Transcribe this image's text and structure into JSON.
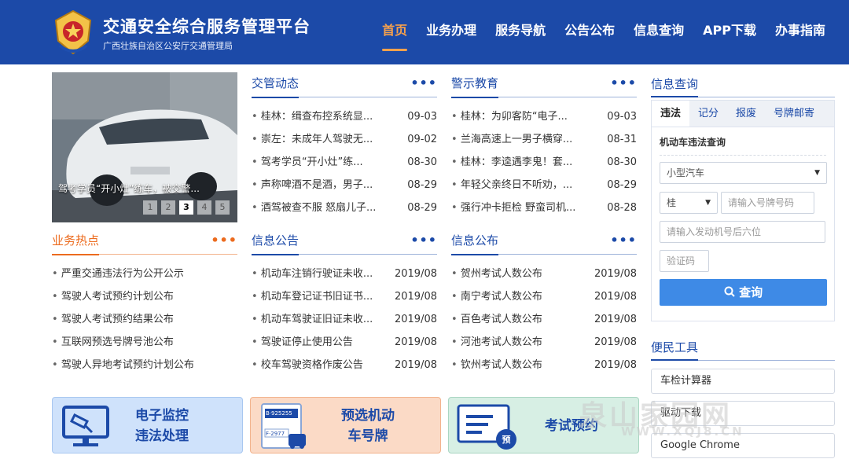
{
  "header": {
    "title": "交通安全综合服务管理平台",
    "subtitle": "广西壮族自治区公安厅交通管理局",
    "nav": [
      "首页",
      "业务办理",
      "服务导航",
      "公告公布",
      "信息查询",
      "APP下载",
      "办事指南"
    ]
  },
  "carousel": {
    "caption": "驾考学员“开小灶”练车，被交警...",
    "dots": [
      "1",
      "2",
      "3",
      "4",
      "5"
    ],
    "active": 3
  },
  "panels": {
    "traffic_news": {
      "title": "交管动态",
      "more": "•••",
      "items": [
        {
          "t": "桂林：缉查布控系统显...",
          "d": "09-03"
        },
        {
          "t": "崇左：未成年人驾驶无...",
          "d": "09-02"
        },
        {
          "t": "驾考学员“开小灶”练...",
          "d": "08-30"
        },
        {
          "t": "声称啤酒不是酒，男子...",
          "d": "08-29"
        },
        {
          "t": "酒驾被查不服 怒扇儿子...",
          "d": "08-29"
        }
      ]
    },
    "warning_edu": {
      "title": "警示教育",
      "more": "•••",
      "items": [
        {
          "t": "桂林：为卯客防“电子...",
          "d": "09-03"
        },
        {
          "t": "兰海高速上一男子横穿...",
          "d": "08-31"
        },
        {
          "t": "桂林：李逵遇李鬼！套...",
          "d": "08-30"
        },
        {
          "t": "年轻父亲终日不听劝，...",
          "d": "08-29"
        },
        {
          "t": "强行冲卡拒检 野蛮司机...",
          "d": "08-28"
        }
      ]
    },
    "hot": {
      "title": "业务热点",
      "more": "•••",
      "items": [
        {
          "t": "严重交通违法行为公开公示",
          "d": ""
        },
        {
          "t": "驾驶人考试预约计划公布",
          "d": ""
        },
        {
          "t": "驾驶人考试预约结果公布",
          "d": ""
        },
        {
          "t": "互联网预选号牌号池公布",
          "d": ""
        },
        {
          "t": "驾驶人异地考试预约计划公布",
          "d": ""
        }
      ]
    },
    "notice": {
      "title": "信息公告",
      "more": "•••",
      "items": [
        {
          "t": "机动车注销行驶证未收...",
          "d": "2019/08"
        },
        {
          "t": "机动车登记证书旧证书...",
          "d": "2019/08"
        },
        {
          "t": "机动车驾驶证旧证未收...",
          "d": "2019/08"
        },
        {
          "t": "驾驶证停止使用公告",
          "d": "2019/08"
        },
        {
          "t": "校车驾驶资格作废公告",
          "d": "2019/08"
        }
      ]
    },
    "publish": {
      "title": "信息公布",
      "more": "•••",
      "items": [
        {
          "t": "贺州考试人数公布",
          "d": "2019/08"
        },
        {
          "t": "南宁考试人数公布",
          "d": "2019/08"
        },
        {
          "t": "百色考试人数公布",
          "d": "2019/08"
        },
        {
          "t": "河池考试人数公布",
          "d": "2019/08"
        },
        {
          "t": "钦州考试人数公布",
          "d": "2019/08"
        }
      ]
    }
  },
  "tiles": {
    "monitor": {
      "line1": "电子监控",
      "line2": "违法处理"
    },
    "plate": {
      "line1": "预选机动",
      "line2": "车号牌",
      "plate_a": "B·925255",
      "plate_b": "F·2977"
    },
    "exam": {
      "line1": "考试预约",
      "badge": "预"
    }
  },
  "query": {
    "title": "信息查询",
    "tabs": [
      "违法",
      "记分",
      "报废",
      "号牌邮寄"
    ],
    "subtitle": "机动车违法查询",
    "vehicle_type": "小型汽车",
    "province": "桂",
    "plate_placeholder": "请输入号牌号码",
    "engine_placeholder": "请输入发动机号后六位",
    "captcha_placeholder": "验证码",
    "button": "查询"
  },
  "tools": {
    "title": "便民工具",
    "items": [
      "车检计算器",
      "驱动下载",
      "Google Chrome"
    ]
  },
  "watermark": {
    "text": "泉山家园网",
    "url": "WWW.XQJ8.CN"
  },
  "colors": {
    "primary": "#1c4aa8",
    "accent": "#ec6b1e",
    "nav_active": "#f7a14c",
    "button": "#3e8ae6"
  }
}
